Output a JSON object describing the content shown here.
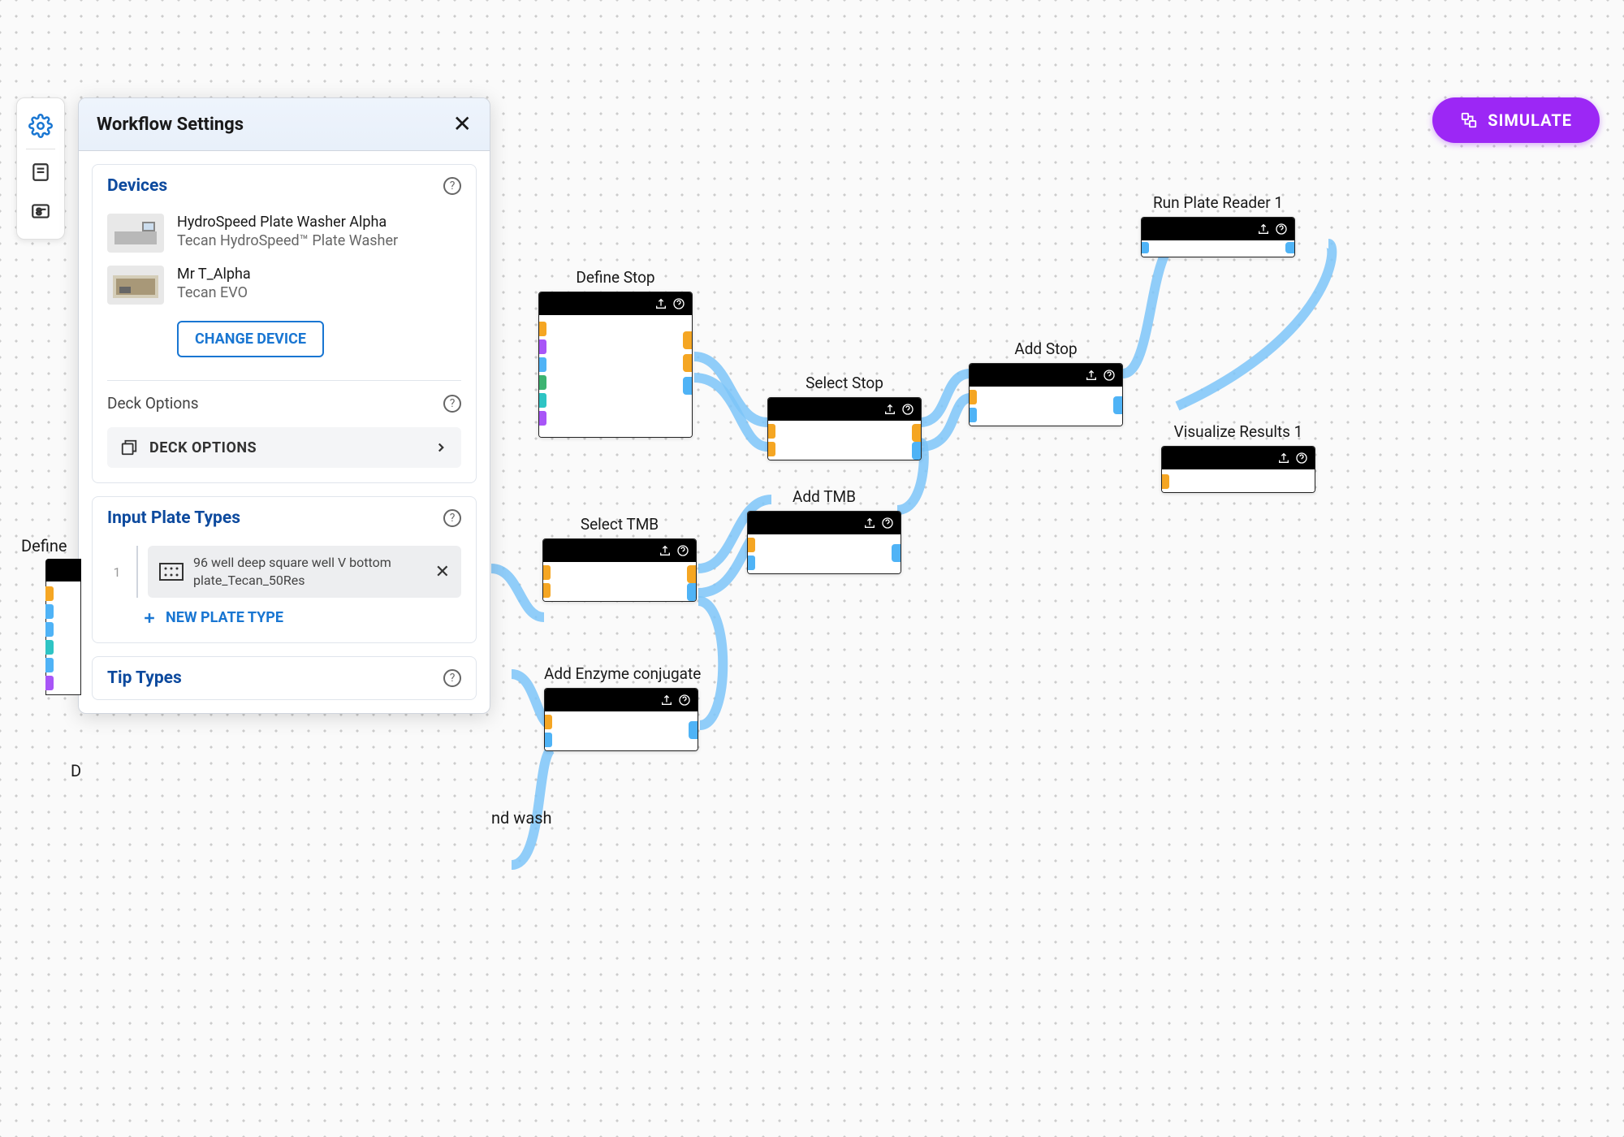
{
  "simulate_label": "SIMULATE",
  "panel": {
    "title": "Workflow Settings",
    "sections": {
      "devices": {
        "title": "Devices",
        "items": [
          {
            "name": "HydroSpeed Plate Washer Alpha",
            "sub": "Tecan HydroSpeed™ Plate Washer"
          },
          {
            "name": "Mr T_Alpha",
            "sub": "Tecan EVO"
          }
        ],
        "change_label": "CHANGE DEVICE",
        "deck_options_label": "Deck Options",
        "deck_button_label": "DECK OPTIONS"
      },
      "plates": {
        "title": "Input Plate Types",
        "items": [
          {
            "index": "1",
            "text": "96 well deep square well V bottom plate_Tecan_50Res"
          }
        ],
        "new_label": "NEW PLATE TYPE"
      },
      "tips": {
        "title": "Tip Types"
      }
    }
  },
  "truncated": {
    "define": "Define",
    "d_short": "D",
    "nd_wash": "nd wash"
  },
  "nodes": {
    "define_stop": "Define Stop",
    "select_stop": "Select Stop",
    "add_stop": "Add Stop",
    "select_tmb": "Select TMB",
    "add_tmb": "Add TMB",
    "add_enzyme": "Add Enzyme conjugate",
    "run_reader": "Run Plate Reader 1",
    "visualize": "Visualize Results 1"
  },
  "colors": {
    "orange": "#f5a623",
    "blue": "#4fb3f6",
    "cyan": "#2ec4c4",
    "purple": "#a855f7",
    "green": "#3cb371"
  }
}
